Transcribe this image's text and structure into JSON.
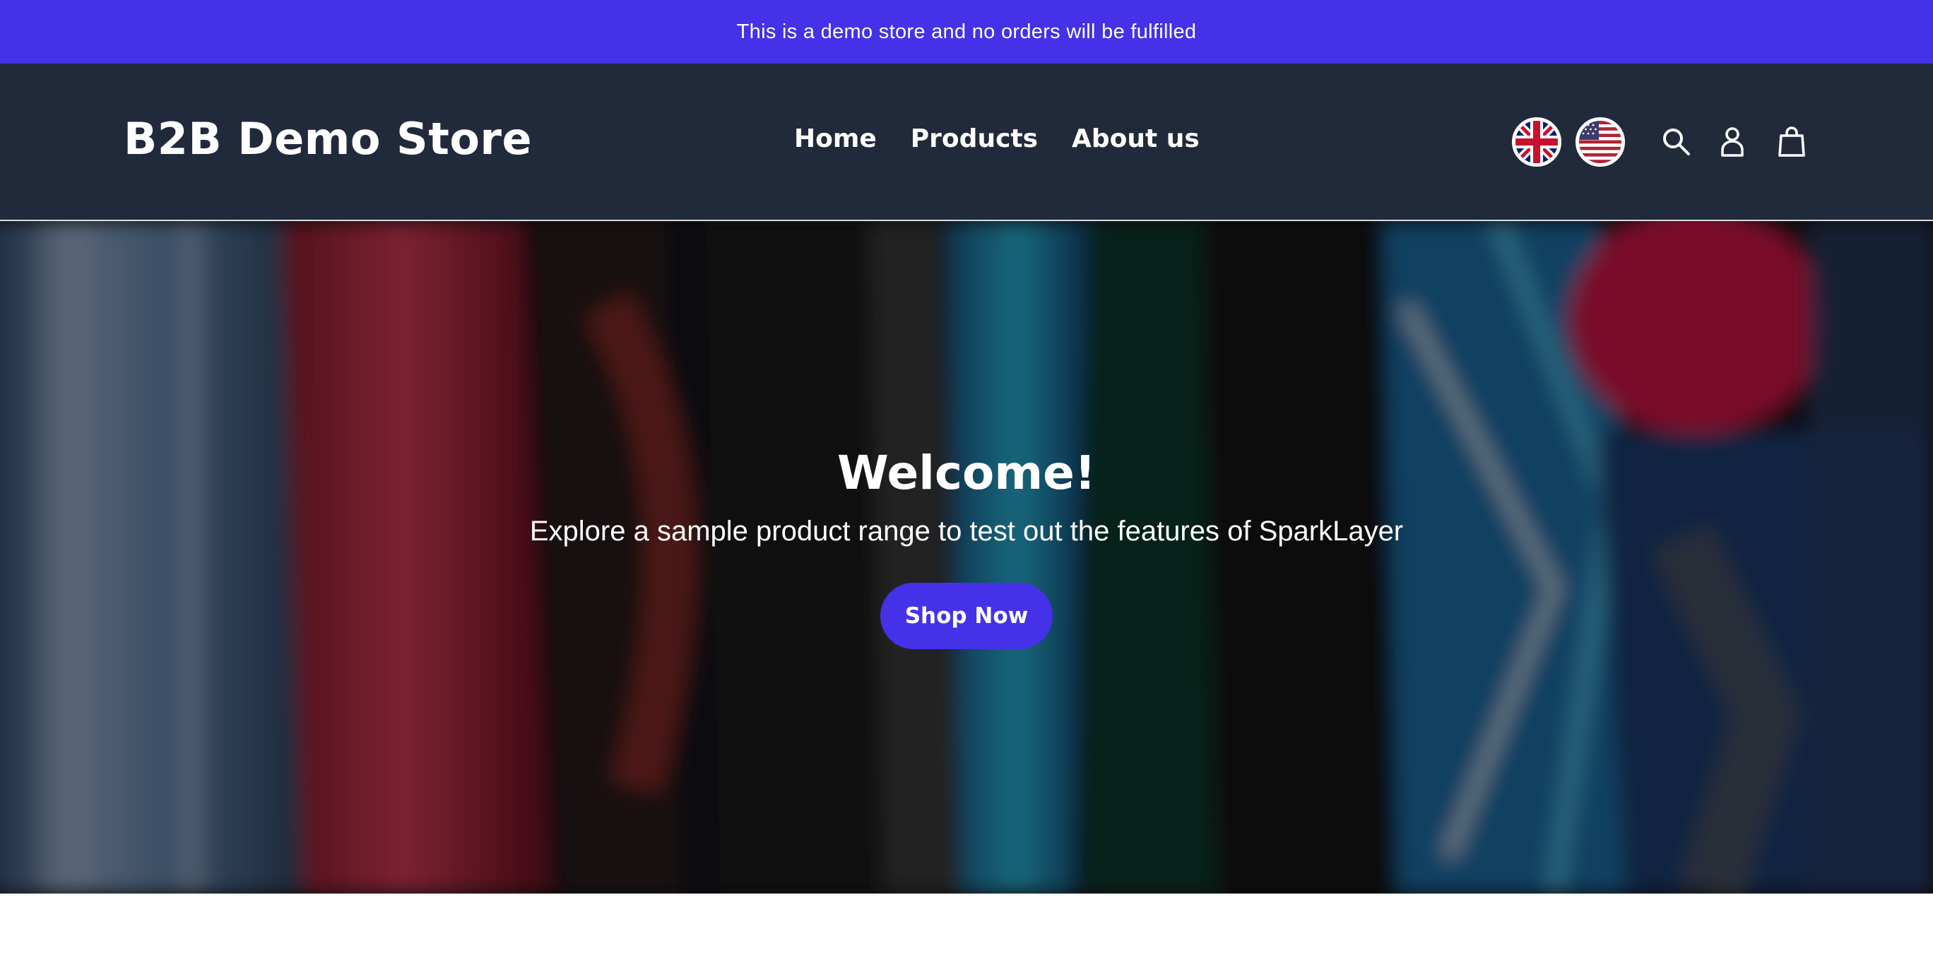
{
  "announcement": {
    "text": "This is a demo store and no orders will be fulfilled"
  },
  "header": {
    "logo": "B2B Demo Store",
    "nav": [
      {
        "label": "Home"
      },
      {
        "label": "Products"
      },
      {
        "label": "About us"
      }
    ],
    "flags": [
      {
        "icon": "uk-flag-icon"
      },
      {
        "icon": "us-flag-icon"
      }
    ],
    "icons": [
      "search-icon",
      "account-icon",
      "cart-icon"
    ]
  },
  "hero": {
    "title": "Welcome!",
    "subtitle": "Explore a sample product range to test out the features of SparkLayer",
    "button_label": "Shop Now"
  },
  "colors": {
    "accent": "#4431e8",
    "header_bg": "#212a3a",
    "text_on_dark": "#ffffff"
  }
}
